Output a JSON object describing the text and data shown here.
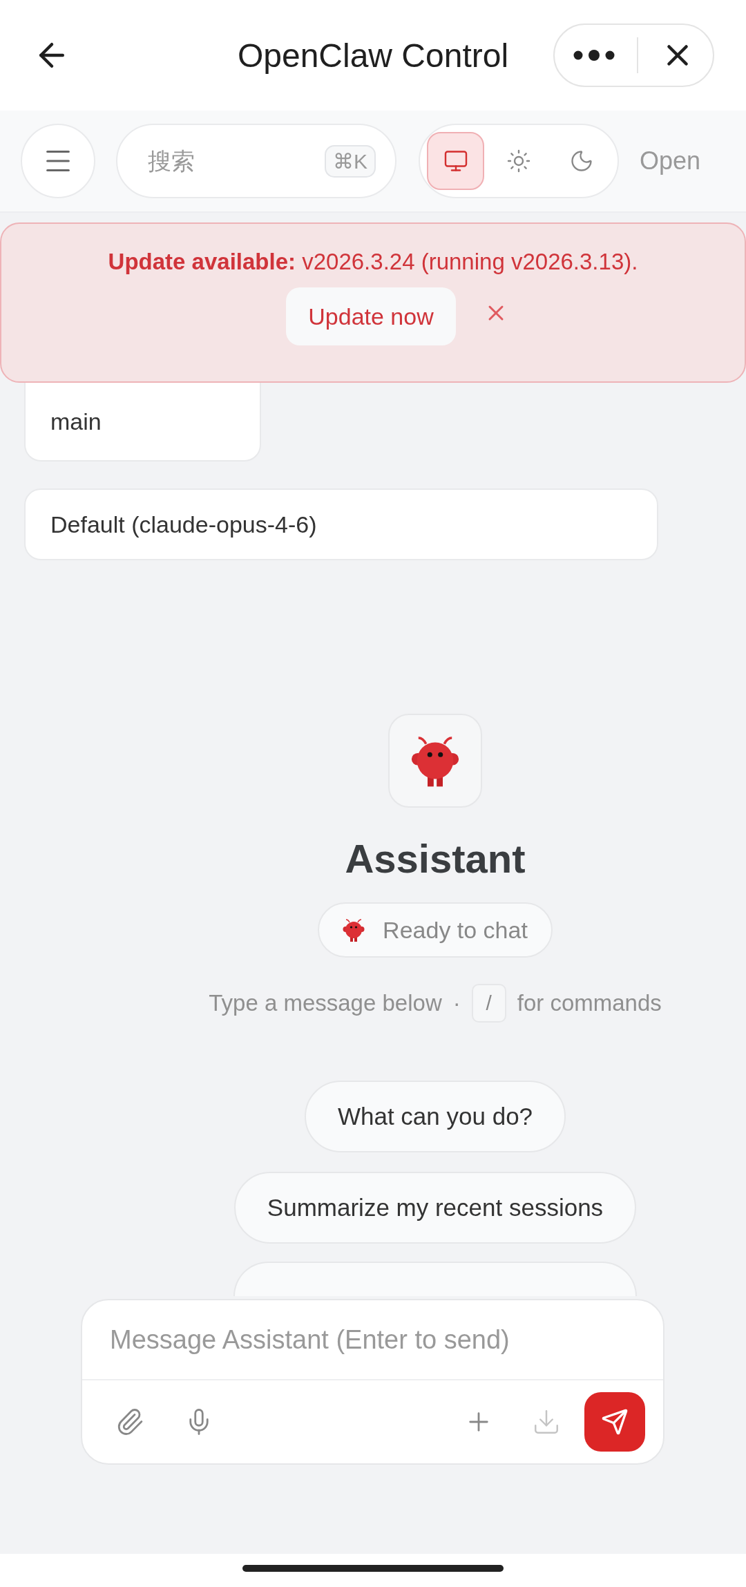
{
  "header": {
    "title": "OpenClaw Control"
  },
  "toolbar": {
    "search": {
      "placeholder": "搜索",
      "shortcut": "⌘K"
    },
    "themes": [
      {
        "kind": "system",
        "selected": true
      },
      {
        "kind": "light",
        "selected": false
      },
      {
        "kind": "dark",
        "selected": false
      }
    ],
    "link": "Open"
  },
  "banner": {
    "message": "**Update available:** v2026.3.24 (running v2026.3.13).",
    "action": "Update now"
  },
  "selectors": [
    {
      "value": "main"
    },
    {
      "value": "Default (claude-opus-4-6)"
    }
  ],
  "assistant": {
    "name": "Assistant",
    "status": "Ready to chat",
    "hint_before": "Type a message below",
    "hint_separator": "·",
    "hint_key": "/",
    "hint_after": "for commands"
  },
  "suggestions": [
    {
      "kind": "full",
      "text": "What can you do?"
    },
    {
      "kind": "full",
      "text": "Summarize my recent sessions"
    },
    {
      "kind": "covered"
    }
  ],
  "composer": {
    "placeholder": "Message Assistant (Enter to send)"
  }
}
